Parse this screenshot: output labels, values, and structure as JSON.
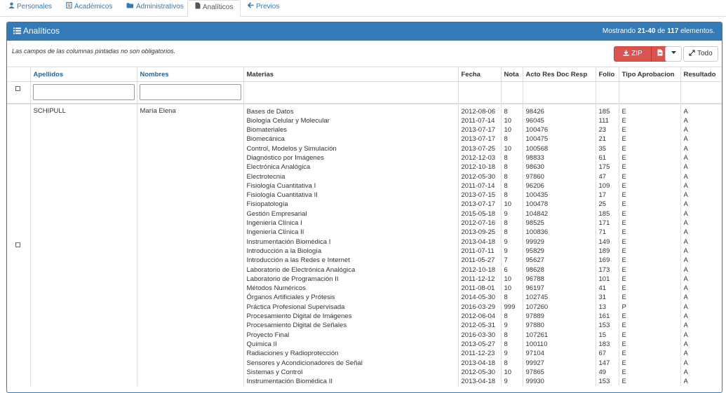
{
  "tabs": [
    {
      "label": "Personales",
      "icon": "user-icon"
    },
    {
      "label": "Académicos",
      "icon": "book-icon"
    },
    {
      "label": "Administrativos",
      "icon": "folder-icon"
    },
    {
      "label": "Analíticos",
      "icon": "file-icon"
    },
    {
      "label": "Previos",
      "icon": "arrow-left-icon"
    }
  ],
  "panel": {
    "title": "Analíticos",
    "showing_prefix": "Mostrando ",
    "showing_range": "21-40",
    "showing_mid": " de ",
    "showing_total": "117",
    "showing_suffix": " elementos.",
    "note": "Las campos de las columnas pintadas no son obligatorios.",
    "zip_label": "ZIP",
    "todo_label": "Todo"
  },
  "columns": {
    "apellidos": "Apellidos",
    "nombres": "Nombres",
    "materias": "Materias",
    "fecha": "Fecha",
    "nota": "Nota",
    "acto": "Acto Res Doc Resp",
    "folio": "Folio",
    "tipo": "Tipo Aprobacion",
    "resultado": "Resultado"
  },
  "record": {
    "apellidos": "SCHIPULL",
    "nombres": "María Elena",
    "materias": [
      "Bases de Datos",
      "Biología Celular y Molecular",
      "Biomateriales",
      "Biomecánica",
      "Control, Modelos y Simulación",
      "Diagnóstico por Imágenes",
      "Electrónica Analógica",
      "Electrotecnia",
      "Fisiología Cuantitativa I",
      "Fisiología Cuantitativa II",
      "Fisiopatología",
      "Gestión Empresarial",
      "Ingeniería Clínica I",
      "Ingeniería Clínica II",
      "Instrumentación Biomédica I",
      "Introducción a la Biología",
      "Introducción a las Redes e Internet",
      "Laboratorio de Electrónica Analógica",
      "Laboratorio de Programación II",
      "Métodos Numéricos",
      "Órganos Artificiales y Prótesis",
      "Práctica Profesional Supervisada",
      "Procesamiento Digital de Imágenes",
      "Procesamiento Digital de Señales",
      "Proyecto Final",
      "Química II",
      "Radiaciones y Radioprotección",
      "Sensores y Acondicionadores de Señal",
      "Sistemas y Control",
      "Instrumentación Biomédica II"
    ],
    "fechas": [
      "2012-08-06",
      "2011-07-14",
      "2013-07-17",
      "2013-07-17",
      "2013-07-25",
      "2012-12-03",
      "2012-10-18",
      "2012-05-30",
      "2011-07-14",
      "2013-07-15",
      "2013-07-17",
      "2015-05-18",
      "2012-07-16",
      "2013-09-25",
      "2013-04-18",
      "2011-07-11",
      "2011-05-27",
      "2012-10-18",
      "2011-12-12",
      "2011-08-01",
      "2014-05-30",
      "2016-03-29",
      "2012-06-04",
      "2012-05-31",
      "2016-03-30",
      "2013-05-27",
      "2011-12-23",
      "2013-04-18",
      "2012-05-30",
      "2013-04-18"
    ],
    "notas": [
      "8",
      "10",
      "10",
      "8",
      "10",
      "8",
      "8",
      "8",
      "8",
      "8",
      "10",
      "9",
      "8",
      "8",
      "9",
      "9",
      "7",
      "6",
      "10",
      "10",
      "8",
      "999",
      "8",
      "9",
      "8",
      "8",
      "9",
      "8",
      "10",
      "9"
    ],
    "actos": [
      "98426",
      "96045",
      "100476",
      "100475",
      "100568",
      "98833",
      "98630",
      "97860",
      "96206",
      "100435",
      "100478",
      "104842",
      "98525",
      "100836",
      "99929",
      "95829",
      "95627",
      "98628",
      "96788",
      "96197",
      "102745",
      "107260",
      "97889",
      "97880",
      "107261",
      "100110",
      "97104",
      "99927",
      "97865",
      "99930"
    ],
    "folios": [
      "185",
      "111",
      "23",
      "21",
      "35",
      "61",
      "175",
      "47",
      "109",
      "17",
      "25",
      "185",
      "171",
      "71",
      "149",
      "189",
      "169",
      "173",
      "101",
      "41",
      "31",
      "13",
      "161",
      "153",
      "15",
      "183",
      "67",
      "147",
      "49",
      "153"
    ],
    "tipos": [
      "E",
      "E",
      "E",
      "E",
      "E",
      "E",
      "E",
      "E",
      "E",
      "E",
      "E",
      "E",
      "E",
      "E",
      "E",
      "E",
      "E",
      "E",
      "E",
      "E",
      "E",
      "P",
      "E",
      "E",
      "E",
      "E",
      "E",
      "E",
      "E",
      "E"
    ],
    "resultados": [
      "A",
      "A",
      "A",
      "A",
      "A",
      "A",
      "A",
      "A",
      "A",
      "A",
      "A",
      "A",
      "A",
      "A",
      "A",
      "A",
      "A",
      "A",
      "A",
      "A",
      "A",
      "A",
      "A",
      "A",
      "A",
      "A",
      "A",
      "A",
      "A",
      "A"
    ]
  },
  "colors": {
    "primary": "#337ab7",
    "danger": "#d9534f",
    "link": "#2a6496"
  }
}
